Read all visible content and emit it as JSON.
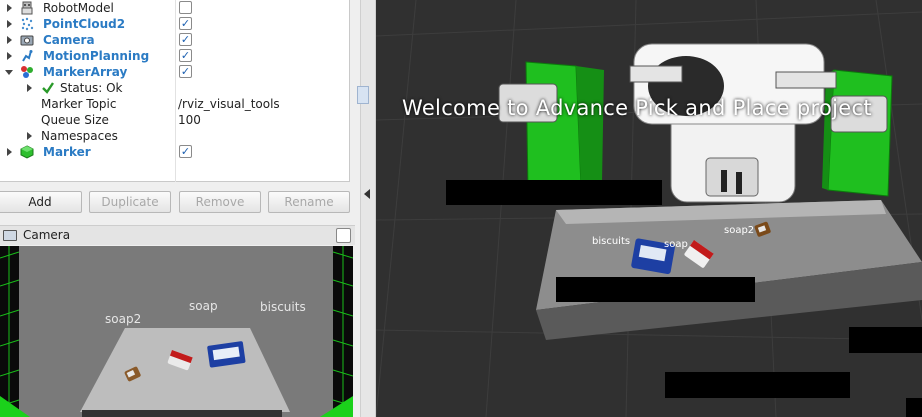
{
  "displays": {
    "items": [
      {
        "name": "RobotModel",
        "bold": false,
        "checked": false,
        "expanded": false,
        "icon": "robot-icon"
      },
      {
        "name": "PointCloud2",
        "bold": true,
        "checked": true,
        "expanded": false,
        "icon": "pointcloud-icon"
      },
      {
        "name": "Camera",
        "bold": true,
        "checked": true,
        "expanded": false,
        "icon": "camera-icon"
      },
      {
        "name": "MotionPlanning",
        "bold": true,
        "checked": true,
        "expanded": false,
        "icon": "motion-planning-icon"
      },
      {
        "name": "MarkerArray",
        "bold": true,
        "checked": true,
        "expanded": true,
        "icon": "marker-array-icon"
      },
      {
        "name": "Marker",
        "bold": true,
        "checked": true,
        "expanded": false,
        "icon": "marker-icon"
      }
    ],
    "marker_array": {
      "status_label": "Status: Ok",
      "topic_label": "Marker Topic",
      "topic_value": "/rviz_visual_tools",
      "queue_label": "Queue Size",
      "queue_value": "100",
      "namespaces_label": "Namespaces"
    },
    "checkmark": "✓"
  },
  "buttons": {
    "add": "Add",
    "duplicate": "Duplicate",
    "remove": "Remove",
    "rename": "Rename"
  },
  "camera_panel": {
    "title": "Camera",
    "labels": {
      "soap2": "soap2",
      "soap": "soap",
      "biscuits": "biscuits"
    }
  },
  "viewport": {
    "welcome_text": "Welcome to Advance Pick and Place project",
    "labels": {
      "biscuits": "biscuits",
      "soap": "soap",
      "soap2": "soap2"
    }
  },
  "colors": {
    "accent": "#2b7bc4",
    "bin_green": "#1fbf1f",
    "status_ok": "#2a9a2a",
    "viewport_bg": "#2f2f2f"
  }
}
